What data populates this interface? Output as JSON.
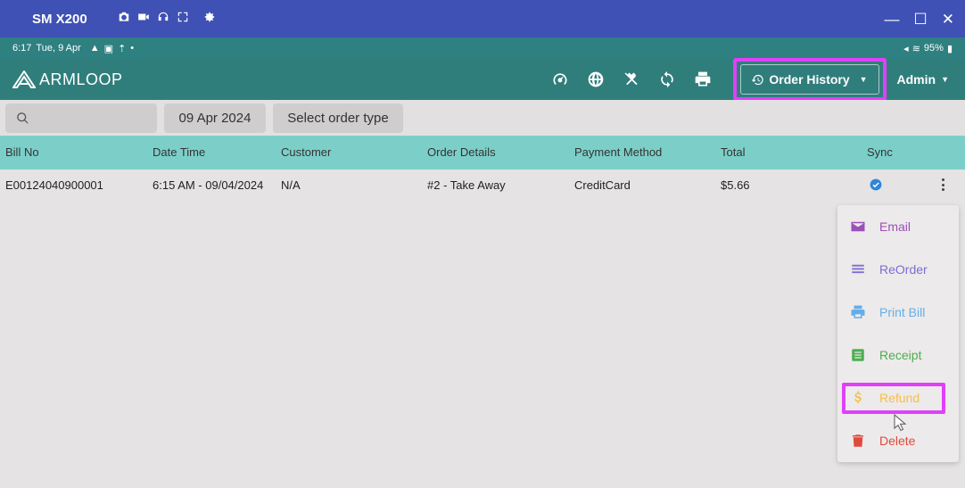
{
  "emulator": {
    "title": "SM X200",
    "tools": [
      "camera-icon",
      "video-icon",
      "headset-icon",
      "fullscreen-icon",
      "settings-icon"
    ],
    "window_controls": [
      "minimize",
      "maximize",
      "close"
    ]
  },
  "status_bar": {
    "time": "6:17",
    "date": "Tue, 9 Apr",
    "battery": "95%"
  },
  "app_bar": {
    "logo": "ARMLOOP",
    "tool_icons": [
      "dashboard-icon",
      "globe-icon",
      "utensils-icon",
      "sync-icon",
      "printer-icon"
    ],
    "order_history_label": "Order History",
    "admin_label": "Admin"
  },
  "filters": {
    "search_placeholder": "",
    "date": "09 Apr 2024",
    "order_type": "Select order type"
  },
  "table": {
    "headers": [
      "Bill No",
      "Date Time",
      "Customer",
      "Order Details",
      "Payment Method",
      "Total",
      "Sync"
    ],
    "rows": [
      {
        "bill_no": "E00124040900001",
        "date_time": "6:15 AM - 09/04/2024",
        "customer": "N/A",
        "order_details": "#2 - Take Away",
        "payment_method": "CreditCard",
        "total": "$5.66",
        "synced": true
      }
    ]
  },
  "menu": {
    "items": [
      {
        "label": "Email",
        "icon": "email-icon",
        "color": "#9c4fb8"
      },
      {
        "label": "ReOrder",
        "icon": "list-icon",
        "color": "#7b6fd6"
      },
      {
        "label": "Print Bill",
        "icon": "printer-icon",
        "color": "#64aee8"
      },
      {
        "label": "Receipt",
        "icon": "receipt-icon",
        "color": "#4caf50"
      },
      {
        "label": "Refund",
        "icon": "dollar-icon",
        "color": "#f6c04a"
      },
      {
        "label": "Delete",
        "icon": "trash-icon",
        "color": "#e04a3c"
      }
    ]
  },
  "colors": {
    "emulator_bar": "#3f51b5",
    "app_bar": "#2f7e7c",
    "table_header": "#7ccfc9",
    "highlight": "#e040fb"
  }
}
